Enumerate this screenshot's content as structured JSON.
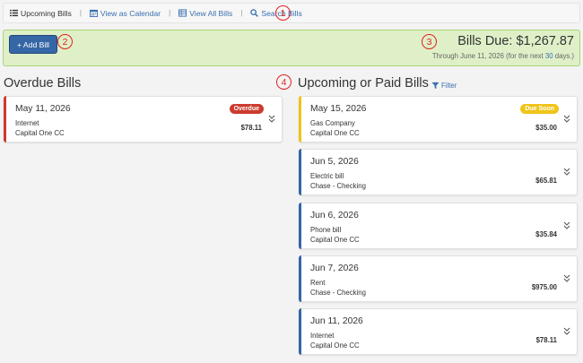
{
  "nav": {
    "upcoming": "Upcoming Bills",
    "calendar": "View as Calendar",
    "all": "View All Bills",
    "search": "Search Bills",
    "separator": "|"
  },
  "toolbar": {
    "add_label": "+ Add Bill"
  },
  "summary": {
    "title_prefix": "Bills Due:",
    "total": "$1,267.87",
    "through_prefix": "Through June 11, 2026 (for the next",
    "days": "30",
    "through_suffix": "days.)"
  },
  "overdue": {
    "heading": "Overdue Bills",
    "bills": [
      {
        "date": "May 11, 2026",
        "name": "Internet",
        "account": "Capital One CC",
        "amount": "$78.11",
        "badge": "Overdue"
      }
    ]
  },
  "upcoming": {
    "heading": "Upcoming or Paid Bills",
    "filter_label": "Filter",
    "bills": [
      {
        "date": "May 15, 2026",
        "name": "Gas Company",
        "account": "Capital One CC",
        "amount": "$35.00",
        "badge": "Due Soon"
      },
      {
        "date": "Jun 5, 2026",
        "name": "Electric bill",
        "account": "Chase - Checking",
        "amount": "$65.81"
      },
      {
        "date": "Jun 6, 2026",
        "name": "Phone bill",
        "account": "Capital One CC",
        "amount": "$35.84"
      },
      {
        "date": "Jun 7, 2026",
        "name": "Rent",
        "account": "Chase - Checking",
        "amount": "$975.00"
      },
      {
        "date": "Jun 11, 2026",
        "name": "Internet",
        "account": "Capital One CC",
        "amount": "$78.11"
      }
    ]
  },
  "annotations": [
    "1",
    "2",
    "3",
    "4"
  ],
  "colors": {
    "link": "#3a6fb0",
    "overdue": "#cc3b2f",
    "due_soon": "#f0c419",
    "upcoming": "#3566a6",
    "banner_bg": "#dff0c8",
    "banner_border": "#a6d47a"
  }
}
